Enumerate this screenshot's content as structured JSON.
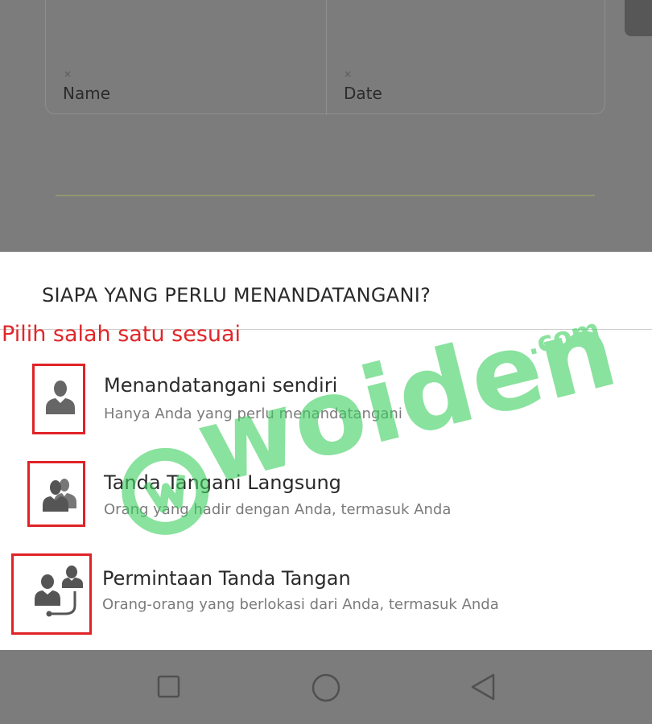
{
  "background": {
    "fields": [
      {
        "clear": "×",
        "label": "Name"
      },
      {
        "clear": "×",
        "label": "Date"
      }
    ]
  },
  "sheet": {
    "title": "SIAPA YANG PERLU MENANDATANGANI?",
    "hint": "Pilih salah satu sesuai",
    "options": [
      {
        "icon": "single-person-icon",
        "title": "Menandatangani sendiri",
        "subtitle": "Hanya Anda yang perlu menandatangani"
      },
      {
        "icon": "two-people-icon",
        "title": "Tanda Tangani Langsung",
        "subtitle": "Orang yang hadir dengan Anda, termasuk Anda"
      },
      {
        "icon": "remote-people-icon",
        "title": "Permintaan Tanda Tangan",
        "subtitle": "Orang-orang yang berlokasi dari Anda, termasuk Anda"
      }
    ]
  },
  "watermark": {
    "brand": "woiden",
    "suffix": ".com",
    "color": "#3ccf5f"
  },
  "navbar": {
    "buttons": [
      "recent-apps-icon",
      "home-icon",
      "back-icon"
    ]
  },
  "colors": {
    "accent_red": "#e0262a",
    "sheet_bg": "#ffffff",
    "scrim": "#7c7c7c"
  }
}
